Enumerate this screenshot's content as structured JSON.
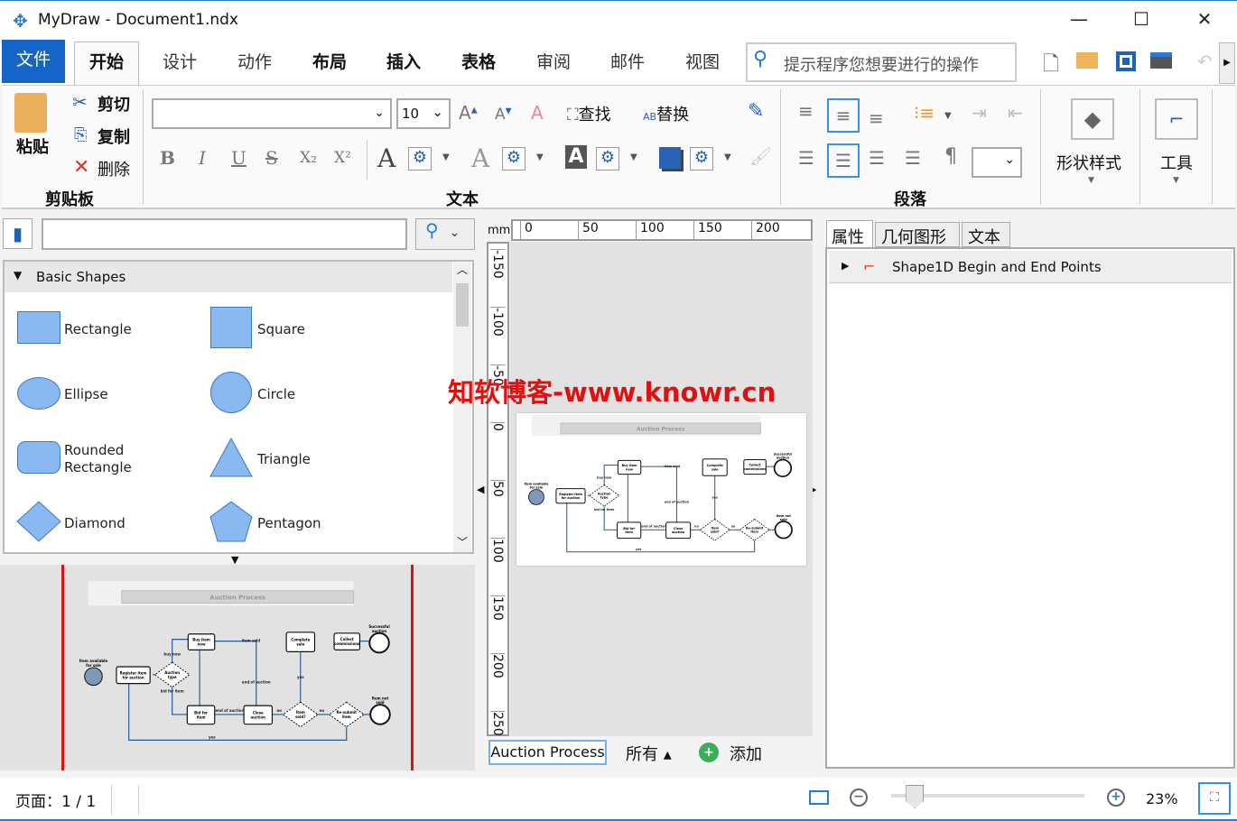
{
  "window": {
    "title": "MyDraw - Document1.ndx",
    "minimize": "—",
    "maximize": "☐",
    "close": "✕"
  },
  "tabs": {
    "file": "文件",
    "items": [
      "开始",
      "设计",
      "动作",
      "布局",
      "插入",
      "表格",
      "审阅",
      "邮件",
      "视图"
    ],
    "search_placeholder": "提示程序您想要进行的操作"
  },
  "ribbon": {
    "clipboard": {
      "paste": "粘贴",
      "cut": "剪切",
      "copy": "复制",
      "delete": "删除",
      "label": "剪贴板"
    },
    "text": {
      "font_value": "",
      "size_value": "10",
      "find": "查找",
      "replace": "替换",
      "label": "文本",
      "bold": "B",
      "italic": "I",
      "underline": "U",
      "strike": "S",
      "sub": "X₂",
      "sup": "X²"
    },
    "paragraph": {
      "label": "段落",
      "pilcrow": "¶"
    },
    "shape_style": {
      "label": "形状样式"
    },
    "tools": {
      "label": "工具"
    }
  },
  "library": {
    "search_value": "",
    "section": "Basic Shapes",
    "shapes": [
      "Rectangle",
      "Square",
      "Ellipse",
      "Circle",
      "Rounded Rectangle",
      "Triangle",
      "Diamond",
      "Pentagon"
    ]
  },
  "ruler": {
    "unit": "mm",
    "h_ticks": [
      "0",
      "50",
      "100",
      "150",
      "200"
    ],
    "v_ticks": [
      "-150",
      "-100",
      "-50",
      "0",
      "50",
      "100",
      "150",
      "200",
      "250"
    ]
  },
  "watermark": "知软博客-www.knowr.cn",
  "diagram": {
    "title": "Auction Process",
    "nodes": {
      "start": "Item available for sale",
      "register": "Register item for auction",
      "type": "Auction type",
      "buy": "Buy item now",
      "bid": "Bid for item",
      "close": "Close auction",
      "sold": "Item sold?",
      "resubmit": "Re-submit item",
      "complete": "Complete sale",
      "collect": "Collect commissions",
      "success": "Successful auction",
      "notsold": "Item not sold"
    },
    "edges": {
      "buynow": "buy now",
      "bidfor": "bid for item",
      "itemsold": "item sold",
      "endauction": "end of auction",
      "endauction2": "end of auction",
      "yes": "yes",
      "no": "no",
      "no2": "no",
      "yes2": "yes"
    }
  },
  "pages": {
    "current_page": "Auction Process",
    "all": "所有 ▴",
    "add": "添加"
  },
  "properties": {
    "tabs": [
      "属性",
      "几何图形",
      "文本"
    ],
    "item": "Shape1D Begin and End Points"
  },
  "status": {
    "page": "页面：1 / 1",
    "zoom": "23%",
    "zoom_percent": 23
  }
}
